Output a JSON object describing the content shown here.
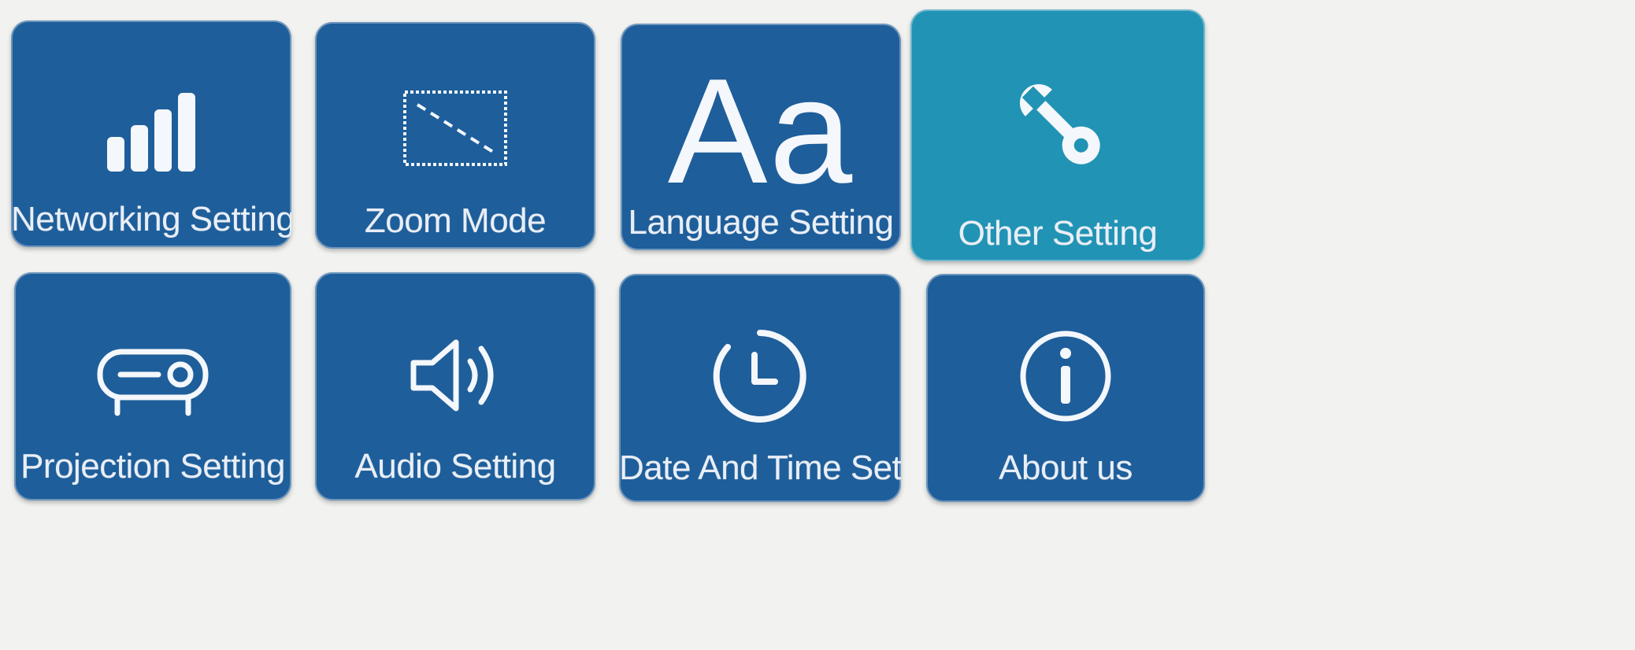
{
  "colors": {
    "tile_default": "#1e5e9a",
    "tile_selected": "#2193b4",
    "icon": "#f4f7fb",
    "label": "#e9eef6",
    "background": "#f2f2f0"
  },
  "tiles": [
    {
      "label": "Networking Setting",
      "icon": "signal-bars-icon",
      "selected": false
    },
    {
      "label": "Zoom Mode",
      "icon": "zoom-frame-icon",
      "selected": false
    },
    {
      "label": "Language Setting",
      "icon": "Aa",
      "selected": false
    },
    {
      "label": "Other Setting",
      "icon": "wrench-icon",
      "selected": true
    },
    {
      "label": "Projection Setting",
      "icon": "projector-icon",
      "selected": false
    },
    {
      "label": "Audio Setting",
      "icon": "speaker-icon",
      "selected": false
    },
    {
      "label": "Date And Time Setting",
      "icon": "clock-icon",
      "selected": false
    },
    {
      "label": "About us",
      "icon": "info-icon",
      "selected": false
    }
  ]
}
